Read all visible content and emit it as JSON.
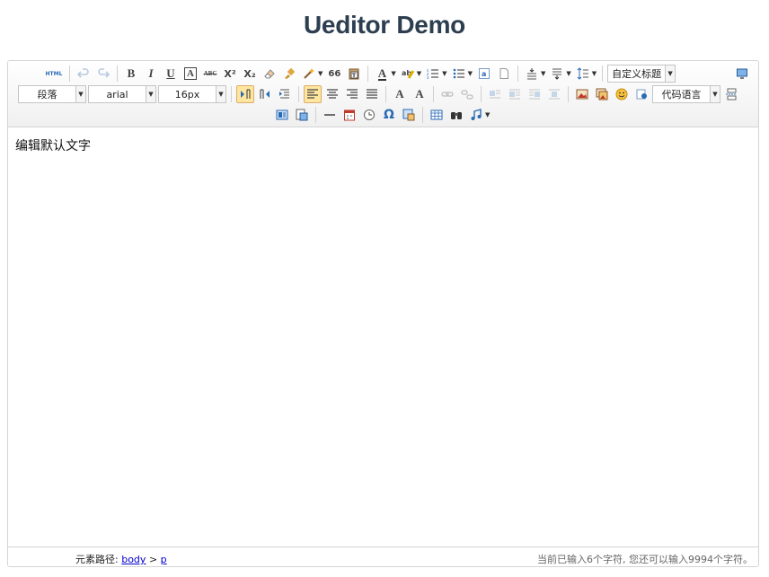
{
  "page": {
    "title": "Ueditor Demo"
  },
  "toolbar": {
    "html_label": "HTML",
    "paragraph_value": "段落",
    "font_family_value": "arial",
    "font_size_value": "16px",
    "custom_title_value": "自定义标题",
    "code_lang_value": "代码语言",
    "quote_glyph": "66",
    "font_color_glyph": "A",
    "bold_glyph": "B",
    "italic_glyph": "I",
    "underline_glyph": "U",
    "boxed_glyph": "A",
    "strike_glyph": "ABC",
    "superscript_glyph": "X²",
    "subscript_glyph": "X₂",
    "omega_glyph": "Ω",
    "font_bigger_glyph": "A",
    "font_smaller_glyph": "A"
  },
  "content": {
    "text": "编辑默认文字"
  },
  "statusbar": {
    "path_label": "元素路径:",
    "path_body": "body",
    "path_sep": ">",
    "path_p": "p",
    "word_count": "当前已输入6个字符, 您还可以输入9994个字符。"
  }
}
